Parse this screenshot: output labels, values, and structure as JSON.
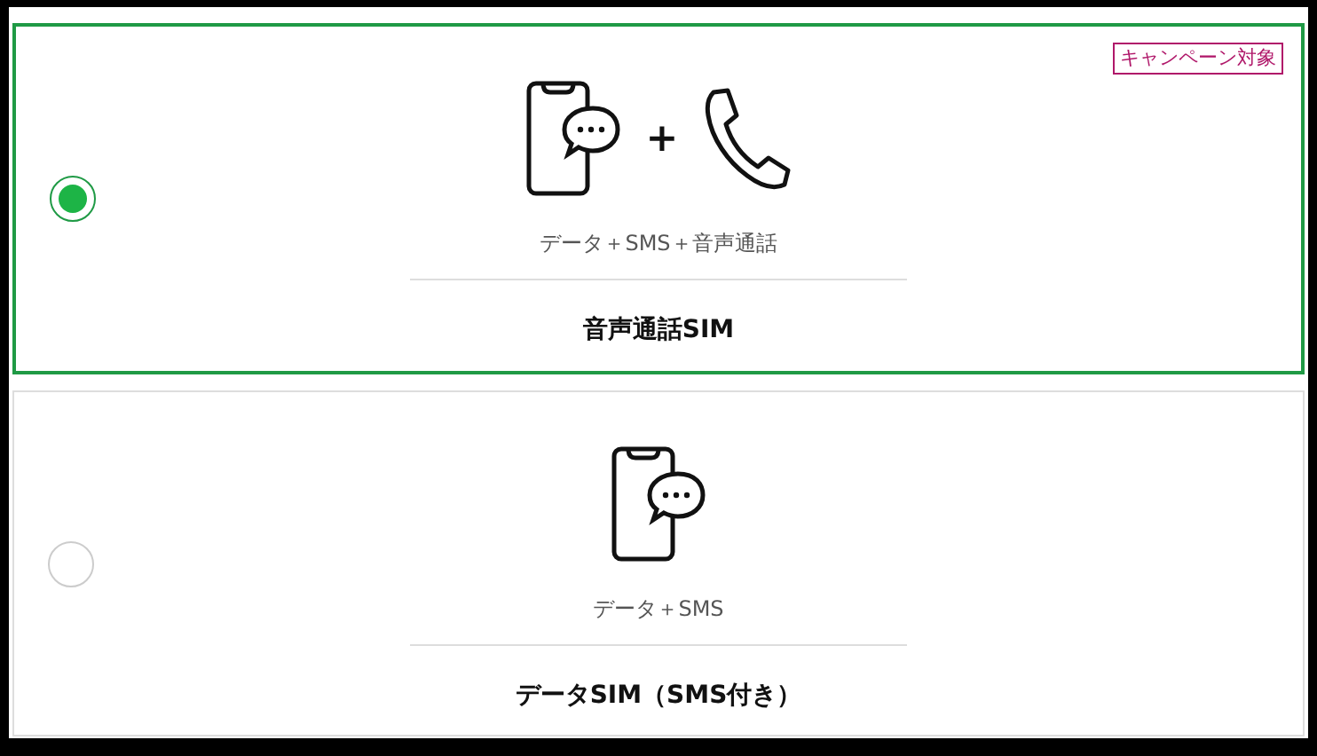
{
  "options": [
    {
      "selected": true,
      "badge": "キャンペーン対象",
      "icons": [
        {
          "kind": "phone-chat"
        },
        {
          "kind": "plus",
          "text": "+"
        },
        {
          "kind": "handset"
        }
      ],
      "caption": "データ＋SMS＋音声通話",
      "title": "音声通話SIM"
    },
    {
      "selected": false,
      "icons": [
        {
          "kind": "phone-chat"
        }
      ],
      "caption": "データ＋SMS",
      "title": "データSIM（SMS付き）"
    }
  ]
}
